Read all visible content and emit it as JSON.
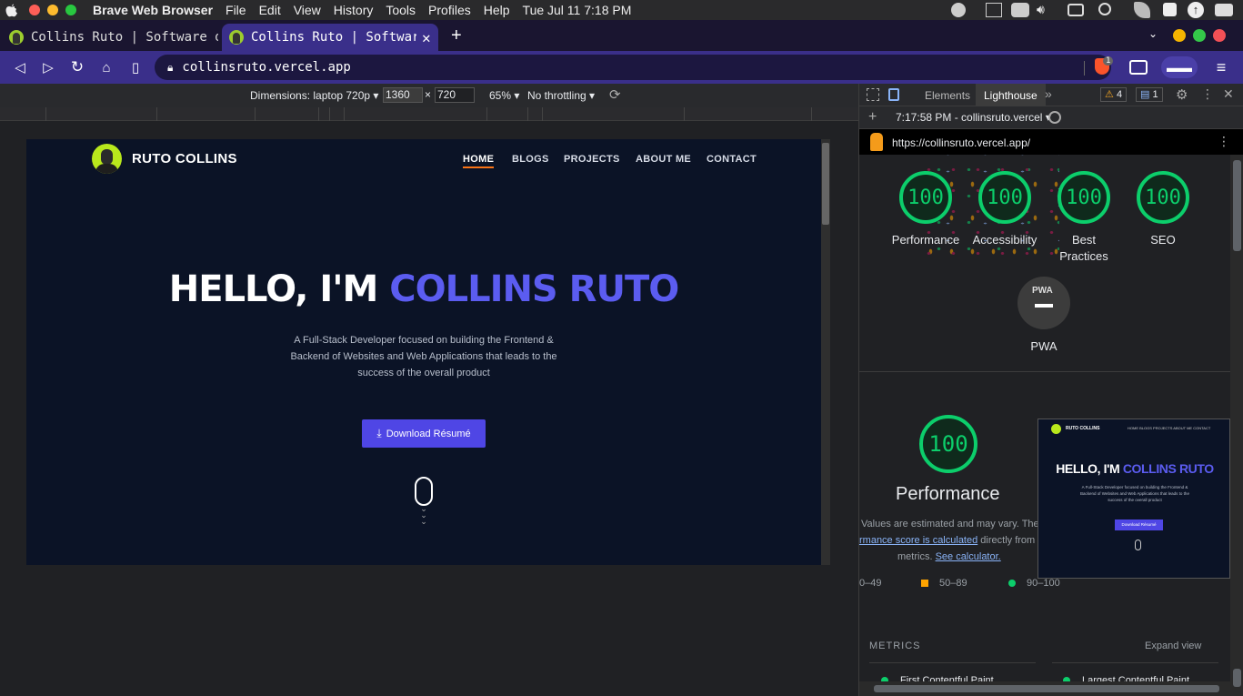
{
  "menubar": {
    "app": "Brave Web Browser",
    "items": [
      "File",
      "Edit",
      "View",
      "History",
      "Tools",
      "Profiles",
      "Help"
    ],
    "clock": "Tue Jul 11  7:18 PM"
  },
  "tabs": [
    {
      "title": "Collins Ruto | Software d"
    },
    {
      "title": "Collins Ruto | Software"
    }
  ],
  "toolbar": {
    "url": "collinsruto.vercel.app",
    "shield_badge": "1"
  },
  "device": {
    "dimensions": "Dimensions: laptop 720p",
    "width": "1360",
    "times": "×",
    "height": "720",
    "zoom": "65%",
    "throttling": "No throttling"
  },
  "site": {
    "logo_text": "RUTO COLLINS",
    "nav": [
      "HOME",
      "BLOGS",
      "PROJECTS",
      "ABOUT ME",
      "CONTACT"
    ],
    "hero_prefix": "HELLO, I'M ",
    "hero_name": "COLLINS RUTO",
    "description": "A Full-Stack Developer focused on building the Frontend & Backend of Websites and Web Applications that leads to the success of the overall product",
    "download": "Download Résumé"
  },
  "devtools": {
    "tabs": [
      "Elements",
      "Lighthouse"
    ],
    "warnings": "4",
    "messages": "1",
    "report_time": "7:17:58 PM - collinsruto.vercel",
    "report_url": "https://collinsruto.vercel.app/",
    "scores": [
      {
        "value": "100",
        "label": "Performance"
      },
      {
        "value": "100",
        "label": "Accessibility"
      },
      {
        "value": "100",
        "label": "Best Practices"
      },
      {
        "value": "100",
        "label": "SEO"
      }
    ],
    "pwa_badge": "PWA",
    "pwa_label": "PWA",
    "perf_score": "100",
    "perf_title": "Performance",
    "note1": "Values are estimated and may vary. The",
    "note2_link": "rmance score is calculated",
    "note2_rest": " directly from th",
    "note3": "metrics. ",
    "note3_link": "See calculator.",
    "legend": [
      "0–49",
      "50–89",
      "90–100"
    ],
    "metrics_label": "METRICS",
    "expand": "Expand view",
    "metric1": "First Contentful Paint",
    "metric2": "Largest Contentful Paint"
  },
  "colors": {
    "accent": "#5b5cf0",
    "good": "#0cce6b",
    "avg": "#ffa400",
    "button": "#4f46e5"
  }
}
